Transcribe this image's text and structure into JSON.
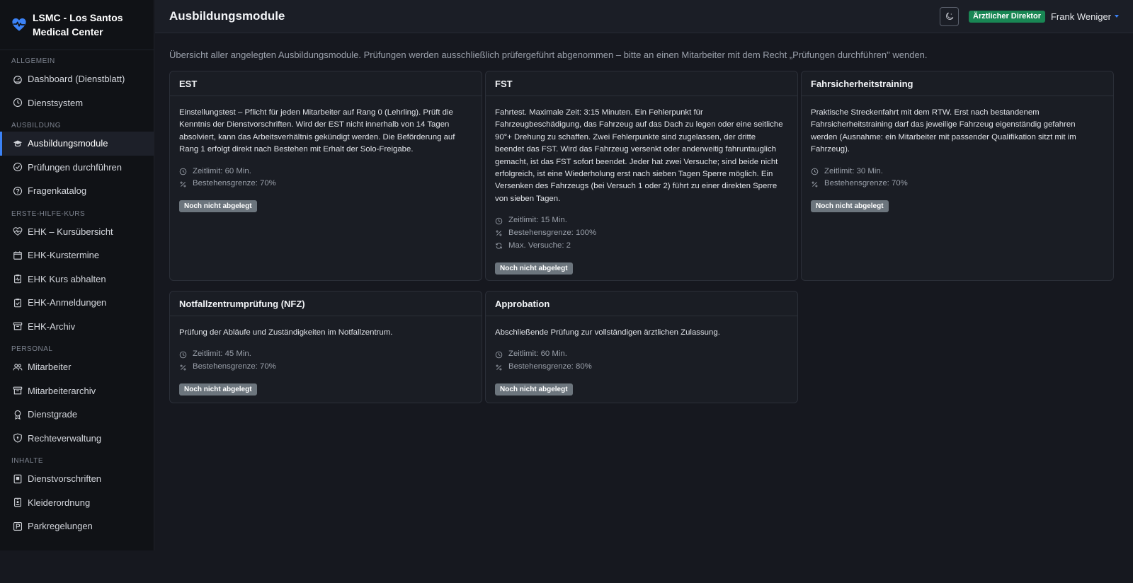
{
  "app": {
    "name_line1": "LSMC - Los Santos",
    "name_line2": "Medical Center",
    "brand_color": "#3b82f6"
  },
  "sidebar": {
    "sections": [
      {
        "label": "ALLGEMEIN",
        "items": [
          {
            "label": "Dashboard (Dienstblatt)",
            "icon": "speedometer-icon"
          },
          {
            "label": "Dienstsystem",
            "icon": "clock-icon"
          }
        ]
      },
      {
        "label": "AUSBILDUNG",
        "items": [
          {
            "label": "Ausbildungsmodule",
            "icon": "mortarboard-icon",
            "active": true
          },
          {
            "label": "Prüfungen durchführen",
            "icon": "check-circle-icon"
          },
          {
            "label": "Fragenkatalog",
            "icon": "question-circle-icon"
          }
        ]
      },
      {
        "label": "ERSTE-HILFE-KURS",
        "items": [
          {
            "label": "EHK – Kursübersicht",
            "icon": "heart-pulse-icon"
          },
          {
            "label": "EHK-Kurstermine",
            "icon": "calendar-icon"
          },
          {
            "label": "EHK Kurs abhalten",
            "icon": "clipboard-pulse-icon"
          },
          {
            "label": "EHK-Anmeldungen",
            "icon": "clipboard-check-icon"
          },
          {
            "label": "EHK-Archiv",
            "icon": "archive-icon"
          }
        ]
      },
      {
        "label": "PERSONAL",
        "items": [
          {
            "label": "Mitarbeiter",
            "icon": "people-icon"
          },
          {
            "label": "Mitarbeiterarchiv",
            "icon": "archive-icon"
          },
          {
            "label": "Dienstgrade",
            "icon": "award-icon"
          },
          {
            "label": "Rechteverwaltung",
            "icon": "shield-icon"
          }
        ]
      },
      {
        "label": "INHALTE",
        "items": [
          {
            "label": "Dienstvorschriften",
            "icon": "journal-icon"
          },
          {
            "label": "Kleiderordnung",
            "icon": "person-badge-icon"
          },
          {
            "label": "Parkregelungen",
            "icon": "parking-icon"
          }
        ]
      }
    ]
  },
  "topbar": {
    "title": "Ausbildungsmodule",
    "theme_icon": "moon-stars-icon",
    "role_badge": "Ärztlicher Direktor",
    "role_color": "#198754",
    "user_name": "Frank Weniger"
  },
  "main": {
    "intro": "Übersicht aller angelegten Ausbildungsmodule. Prüfungen werden ausschließlich prüfergeführt abgenommen – bitte an einen Mitarbeiter mit dem Recht „Prüfungen durchführen\" wenden.",
    "modules": [
      {
        "title": "EST",
        "desc_lines": [
          "Einstellungstest – Pflicht für jeden Mitarbeiter auf Rang 0 (Lehrling). Prüft die",
          "Kenntnis der Dienstvorschriften. Wird der EST nicht innerhalb von 14 Tagen",
          "absolviert, kann das Arbeitsverhältnis gekündigt werden. Die Beförderung auf",
          "Rang 1 erfolgt direkt nach Bestehen mit Erhalt der Solo-Freigabe."
        ],
        "meta": [
          {
            "icon": "clock-icon",
            "text": "Zeitlimit: 60 Min."
          },
          {
            "icon": "percent-icon",
            "text": "Bestehensgrenze: 70%"
          }
        ],
        "status": "Noch nicht abgelegt"
      },
      {
        "title": "FST",
        "desc_lines": [
          "Fahrtest. Maximale Zeit: 3:15 Minuten. Ein Fehlerpunkt für",
          "Fahrzeugbeschädigung, das Fahrzeug auf das Dach zu legen oder eine seitliche",
          "90°+ Drehung zu schaffen. Zwei Fehlerpunkte sind zugelassen, der dritte",
          "beendet das FST. Wird das Fahrzeug versenkt oder anderweitig fahruntauglich",
          "gemacht, ist das FST sofort beendet. Jeder hat zwei Versuche; sind beide nicht",
          "erfolgreich, ist eine Wiederholung erst nach sieben Tagen Sperre möglich. Ein",
          "Versenken des Fahrzeugs (bei Versuch 1 oder 2) führt zu einer direkten Sperre",
          "von sieben Tagen."
        ],
        "meta": [
          {
            "icon": "clock-icon",
            "text": "Zeitlimit: 15 Min."
          },
          {
            "icon": "percent-icon",
            "text": "Bestehensgrenze: 100%"
          },
          {
            "icon": "repeat-icon",
            "text": "Max. Versuche: 2"
          }
        ],
        "status": "Noch nicht abgelegt"
      },
      {
        "title": "Fahrsicherheitstraining",
        "desc_lines": [
          "Praktische Streckenfahrt mit dem RTW. Erst nach bestandenem",
          "Fahrsicherheitstraining darf das jeweilige Fahrzeug eigenständig gefahren",
          "werden (Ausnahme: ein Mitarbeiter mit passender Qualifikation sitzt mit im",
          "Fahrzeug)."
        ],
        "meta": [
          {
            "icon": "clock-icon",
            "text": "Zeitlimit: 30 Min."
          },
          {
            "icon": "percent-icon",
            "text": "Bestehensgrenze: 70%"
          }
        ],
        "status": "Noch nicht abgelegt"
      },
      {
        "title": "Notfallzentrumprüfung (NFZ)",
        "desc_lines": [
          "Prüfung der Abläufe und Zuständigkeiten im Notfallzentrum."
        ],
        "meta": [
          {
            "icon": "clock-icon",
            "text": "Zeitlimit: 45 Min."
          },
          {
            "icon": "percent-icon",
            "text": "Bestehensgrenze: 70%"
          }
        ],
        "status": "Noch nicht abgelegt"
      },
      {
        "title": "Approbation",
        "desc_lines": [
          "Abschließende Prüfung zur vollständigen ärztlichen Zulassung."
        ],
        "meta": [
          {
            "icon": "clock-icon",
            "text": "Zeitlimit: 60 Min."
          },
          {
            "icon": "percent-icon",
            "text": "Bestehensgrenze: 80%"
          }
        ],
        "status": "Noch nicht abgelegt"
      }
    ]
  }
}
